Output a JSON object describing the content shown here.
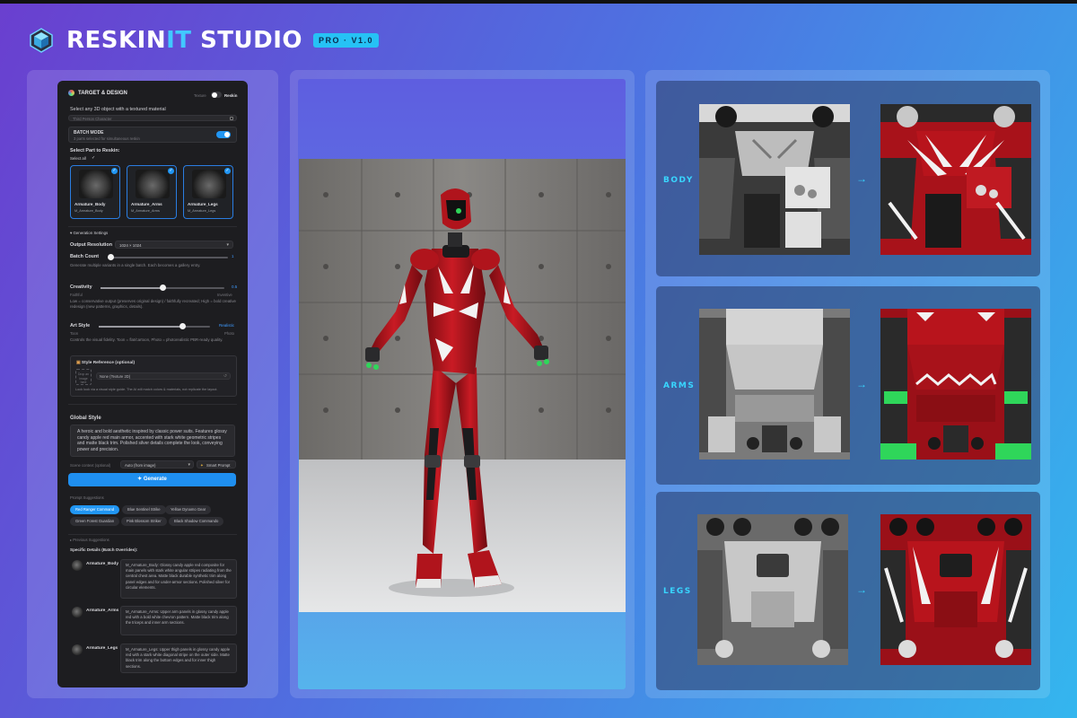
{
  "app": {
    "title_main": "RESKIN",
    "title_accent": "IT",
    "title_tail": " STUDIO",
    "badge": "PRO · V1.0"
  },
  "panel": {
    "section_title": "TARGET & DESIGN",
    "mode_texture": "Texture",
    "mode_reskin": "Reskin",
    "select_object_label": "Select any 3D object with a textured material",
    "object_field_value": "Third Person Character",
    "batch_mode_label": "BATCH MODE",
    "batch_mode_desc": "3 parts selected for simultaneous reskin",
    "select_part_label": "Select Part to Reskin:",
    "select_all": "Select all",
    "parts": [
      {
        "name": "Armature_Body",
        "sub": "M_Armature_Body"
      },
      {
        "name": "Armature_Arms",
        "sub": "M_Armature_Arms"
      },
      {
        "name": "Armature_Legs",
        "sub": "M_Armature_Legs"
      }
    ],
    "generation_settings": "Generation Settings",
    "output_resolution_label": "Output Resolution",
    "output_resolution_value": "1024 × 1024",
    "batch_count_label": "Batch Count",
    "batch_count_value": "1",
    "batch_count_desc": "Generate multiple variants in a single batch. Each becomes a gallery entry.",
    "creativity_label": "Creativity",
    "creativity_value": "0.5",
    "creativity_min": "Faithful",
    "creativity_max": "Inventive",
    "creativity_level": 0.5,
    "creativity_desc": "Low = conservative output (preserves original design) / faithfully recreated; High = bold creative redesign (new patterns, graphics, details).",
    "art_style_label": "Art Style",
    "art_style_value": "Realistic",
    "art_style_min": "Toon",
    "art_style_max": "Photo",
    "art_style_level": 0.75,
    "art_style_desc": "Controls the visual fidelity. Toon = flat/cartoon, Photo = photorealistic PBR-ready quality.",
    "style_ref_label": "Style Reference (optional)",
    "style_ref_drop": "Drop an image here",
    "style_ref_value": "None (Texture 2D)",
    "style_ref_desc": "Lock look via a visual style guide. The AI will match colors & materials, not replicate the layout.",
    "global_style_label": "Global Style",
    "global_style_text": "A heroic and bold aesthetic inspired by classic power suits. Features glossy candy apple red main armor, accented with stark white geometric stripes and matte black trim. Polished silver details complete the look, conveying power and precision.",
    "scene_context_label": "Scene context (optional)",
    "scene_context_value": "Auto (from image)",
    "smart_prompt": "Smart Prompt",
    "generate_button": "Generate",
    "prompt_suggestions_label": "Prompt Suggestions",
    "suggestions": [
      "Red Ranger Command",
      "Blue Sentinel Strike",
      "Yellow Dynamo Gear",
      "Green Forest Guardian",
      "Pink Blossom Striker",
      "Black Shadow Commando"
    ],
    "previous_suggestions": "Previous Suggestions",
    "specific_details_label": "Specific Details (Batch Overrides):",
    "details": [
      {
        "name": "Armature_Body",
        "text": "M_Armature_Body: Glossy candy apple red composite for main panels with stark white angular stripes radiating from the central chest area. Matte black durable synthetic trim along panel edges and for under-armor sections. Polished silver for circular elements."
      },
      {
        "name": "Armature_Arms",
        "text": "M_Armature_Arms: Upper arm panels in glossy candy apple red with a bold white chevron pattern. Matte black trim along the triceps and inner arm sections."
      },
      {
        "name": "Armature_Legs",
        "text": "M_Armature_Legs: Upper thigh panels in glossy candy apple red with a stark white diagonal stripe on the outer side. Matte black trim along the bottom edges and for inner thigh sections."
      }
    ]
  },
  "comparison": {
    "rows": [
      {
        "label": "BODY"
      },
      {
        "label": "ARMS"
      },
      {
        "label": "LEGS"
      }
    ],
    "arrow": "→"
  },
  "colors": {
    "accent": "#38d6ff",
    "primary_blue": "#2196f3",
    "suit_red": "#b0141c",
    "suit_white": "#f2f2f2"
  }
}
